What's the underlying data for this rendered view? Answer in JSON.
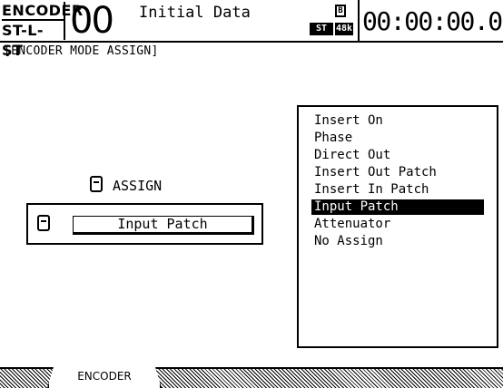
{
  "header": {
    "mode_line1": "ENCODER",
    "mode_line2": "ST-L-ST",
    "scene_number": "00",
    "scene_title": "Initial Data",
    "memory_icon": "B",
    "badge_st": "ST",
    "badge_fs": "48k",
    "timecode": "00:00:00.00"
  },
  "page": {
    "label": "[ENCODER MODE ASSIGN]"
  },
  "assign": {
    "label": "ASSIGN",
    "icon": "knob-icon",
    "patch_value": "Input Patch"
  },
  "list": {
    "items": [
      "Insert On",
      "Phase",
      "Direct Out",
      "Insert Out Patch",
      "Insert In Patch",
      "Input Patch",
      "Attenuator",
      "No Assign"
    ],
    "selected_index": 5
  },
  "tabs": {
    "active": "ENCODER"
  }
}
